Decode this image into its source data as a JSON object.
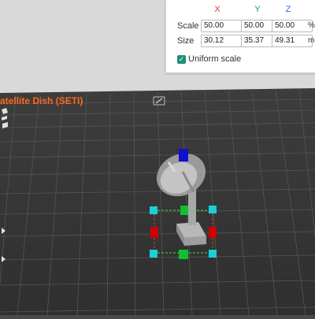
{
  "scale_panel": {
    "axis_x": "X",
    "axis_y": "Y",
    "axis_z": "Z",
    "scale_label": "Scale",
    "size_label": "Size",
    "scale_x": "50.00",
    "scale_y": "50.00",
    "scale_z": "50.00",
    "scale_unit": "%",
    "size_x": "30.12",
    "size_y": "35.37",
    "size_z": "49.31",
    "size_unit": "mm",
    "uniform_scale_label": "Uniform scale",
    "uniform_scale_checked": true
  },
  "model": {
    "name": "atellite Dish (SETI)"
  },
  "icons": {
    "edit": "edit-name-icon",
    "left_toolbar": [
      "toolbar-icon-1",
      "toolbar-icon-2"
    ]
  },
  "colors": {
    "accent": "#1f8f7a",
    "model_name": "#ff6a1a",
    "axis_x": "#e03a3a",
    "axis_y": "#1aa34a",
    "axis_z": "#2d6bd8",
    "bed": "#3c3c3c"
  }
}
